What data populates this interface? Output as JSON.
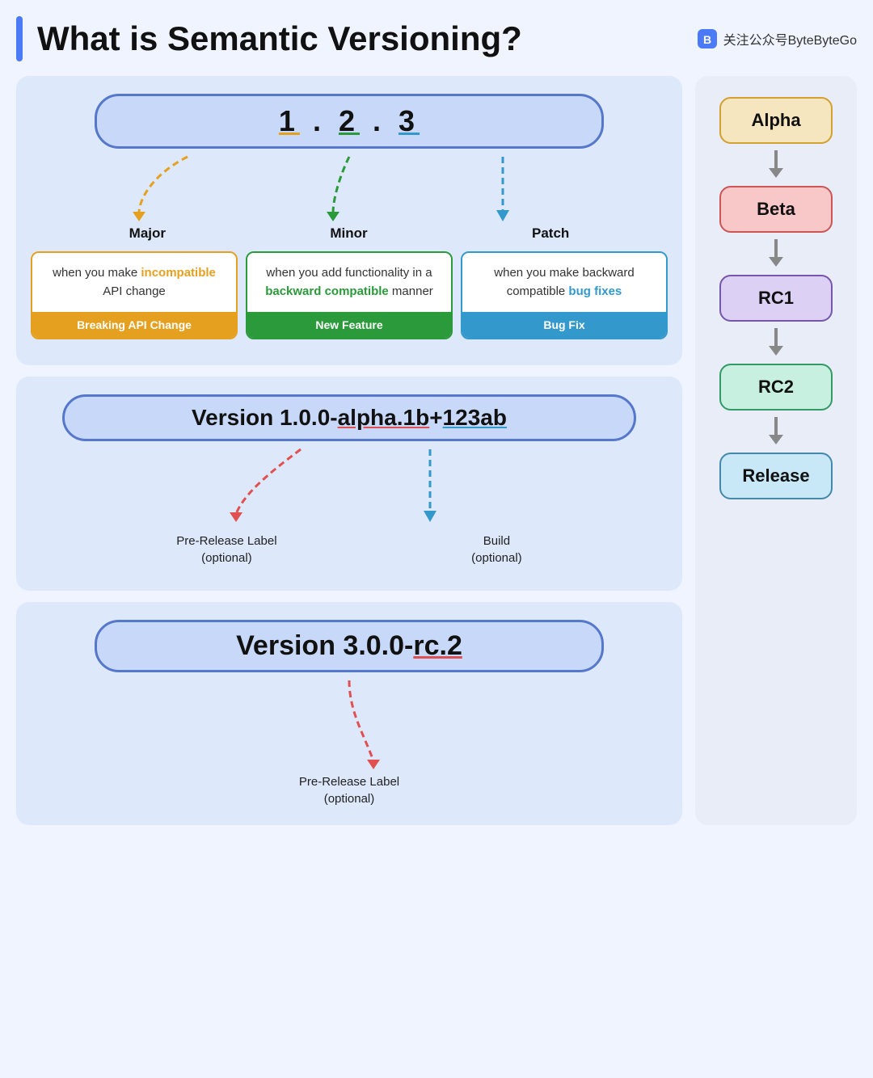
{
  "page": {
    "title": "What is Semantic Versioning?",
    "brand": "关注公众号ByteByteGo"
  },
  "section1": {
    "version_display": "Version 1.2.3",
    "version_1": "1",
    "version_dot1": ".",
    "version_2": "2",
    "version_dot2": ".",
    "version_3": "3",
    "major_label": "Major",
    "minor_label": "Minor",
    "patch_label": "Patch",
    "major_desc_prefix": "when you make ",
    "major_desc_colored": "incompatible",
    "major_desc_suffix": " API change",
    "major_footer": "Breaking API Change",
    "minor_desc_prefix": "when you add functionality in a ",
    "minor_desc_colored": "backward compatible",
    "minor_desc_suffix": " manner",
    "minor_footer": "New Feature",
    "patch_desc_prefix": "when you make backward compatible ",
    "patch_desc_colored": "bug fixes",
    "patch_footer": "Bug Fix"
  },
  "section2": {
    "version_display": "Version 1.0.0-alpha.1b+123ab",
    "prerelease_label": "Pre-Release Label",
    "prerelease_optional": "(optional)",
    "build_label": "Build",
    "build_optional": "(optional)"
  },
  "section3": {
    "version_display": "Version 3.0.0-rc.2",
    "prerelease_label": "Pre-Release Label",
    "prerelease_optional": "(optional)"
  },
  "right_col": {
    "items": [
      {
        "label": "Alpha",
        "class": "alpha-item"
      },
      {
        "label": "Beta",
        "class": "beta-item"
      },
      {
        "label": "RC1",
        "class": "rc1-item"
      },
      {
        "label": "RC2",
        "class": "rc2-item"
      },
      {
        "label": "Release",
        "class": "release-item-box"
      }
    ]
  }
}
